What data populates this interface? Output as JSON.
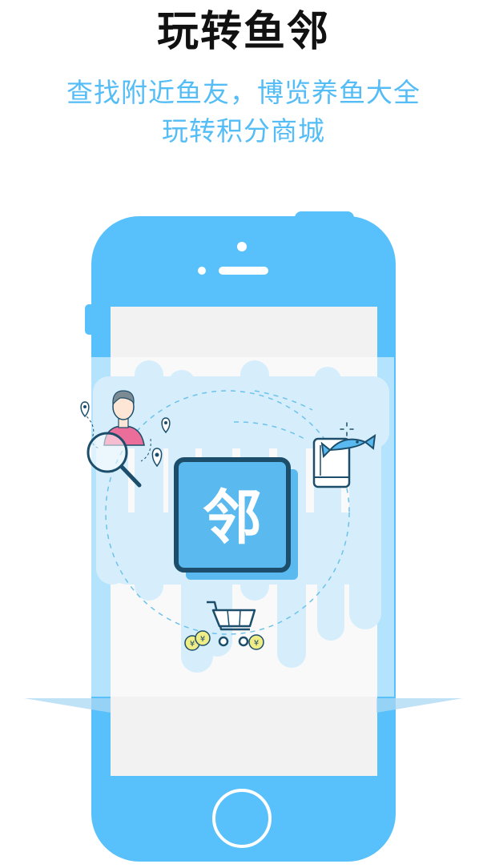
{
  "headline": "玩转鱼邻",
  "subtitle_line1": "查找附近鱼友，博览养鱼大全",
  "subtitle_line2": "玩转积分商城",
  "logo_glyph": "邻",
  "coin_symbol": "¥",
  "colors": {
    "accent": "#55bdf6",
    "phone_body": "#58c0fa",
    "dark_navy": "#1c4e6b",
    "headline": "#111111",
    "screen": "#f2f2f2",
    "coin": "#f0ed86"
  },
  "icons": {
    "phone_button": "home-button",
    "search": "magnifier-icon",
    "profile": "user-avatar-icon",
    "fish_book": "fish-book-icon",
    "cart": "shopping-cart-icon"
  }
}
